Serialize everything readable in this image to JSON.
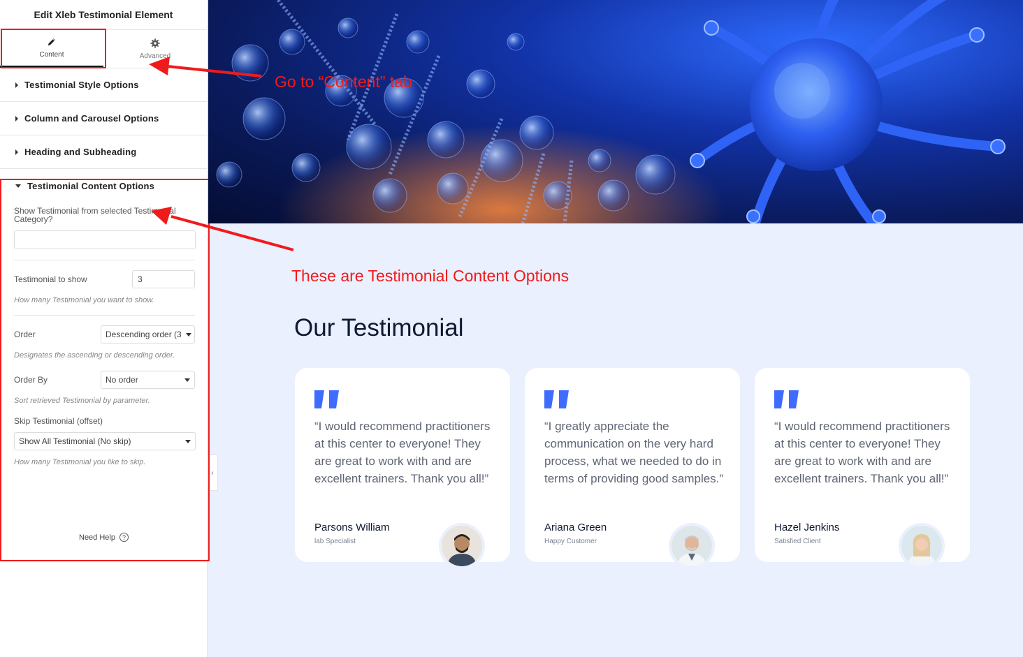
{
  "sidebar": {
    "title": "Edit Xleb Testimonial Element",
    "tabs": [
      {
        "label": "Content",
        "icon": "pencil-icon",
        "active": true
      },
      {
        "label": "Advanced",
        "icon": "gear-icon",
        "active": false
      }
    ],
    "sections": [
      {
        "label": "Testimonial Style Options"
      },
      {
        "label": "Column and Carousel Options"
      },
      {
        "label": "Heading and Subheading"
      },
      {
        "label": "Testimonial Content Options"
      }
    ],
    "content_options": {
      "category_label": "Show Testimonial from selected Testimonial Category?",
      "category_value": "",
      "to_show_label": "Testimonial to show",
      "to_show_value": "3",
      "to_show_help": "How many Testimonial you want to show.",
      "order_label": "Order",
      "order_value": "Descending order (3",
      "order_help": "Designates the ascending or descending order.",
      "order_by_label": "Order By",
      "order_by_value": "No order",
      "order_by_help": "Sort retrieved Testimonial by parameter.",
      "skip_label": "Skip Testimonial (offset)",
      "skip_value": "Show All Testimonial (No skip)",
      "skip_help": "How many Testimonial you like to skip."
    },
    "need_help": "Need Help",
    "need_help_icon": "?"
  },
  "annotations": {
    "content_tab": "Go  to “Content” tab",
    "options": "These are Testimonial Content Options",
    "color": "#ef1b1b"
  },
  "main": {
    "title": "Our Testimonial",
    "accent": "#3f6bff",
    "cards": [
      {
        "quote": "“I would recommend practitioners at this center to everyone! They are great to work with and are excellent trainers. Thank you all!”",
        "name": "Parsons William",
        "role": "lab Specialist"
      },
      {
        "quote": "“I greatly appreciate the communication on the very hard process, what we needed to do in terms of providing good samples.”",
        "name": "Ariana Green",
        "role": "Happy Customer"
      },
      {
        "quote": "“I would recommend practitioners at this center to everyone! They are great to work with and are excellent trainers. Thank you all!”",
        "name": "Hazel Jenkins",
        "role": "Satisfied Client"
      }
    ]
  }
}
